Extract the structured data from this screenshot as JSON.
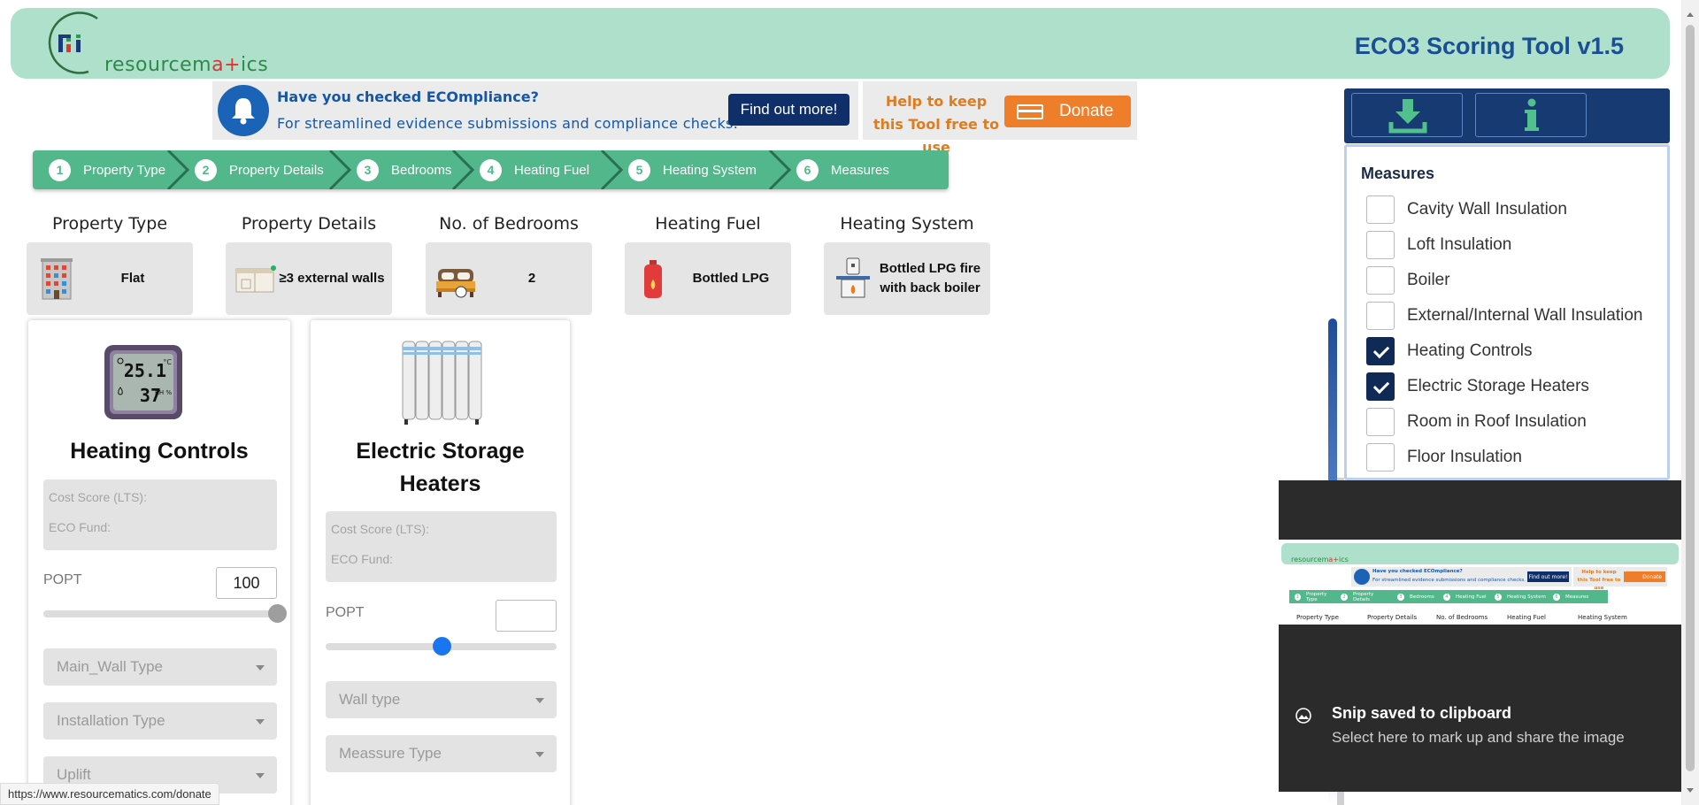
{
  "header": {
    "logo_prefix": "resourcem",
    "logo_accent": "a+",
    "logo_suffix": "ics",
    "app_title": "ECO3 Scoring Tool v1.5"
  },
  "banner": {
    "line1": "Have you checked ECOmpliance?",
    "line2": "For streamlined evidence submissions and compliance checks.",
    "find_out_more": "Find out more!",
    "help_text": "Help to keep this Tool free to use",
    "donate": "Donate"
  },
  "steps": [
    {
      "num": "1",
      "label": "Property Type"
    },
    {
      "num": "2",
      "label": "Property Details"
    },
    {
      "num": "3",
      "label": "Bedrooms"
    },
    {
      "num": "4",
      "label": "Heating Fuel"
    },
    {
      "num": "5",
      "label": "Heating System"
    },
    {
      "num": "6",
      "label": "Measures"
    }
  ],
  "summary": [
    {
      "label": "Property Type",
      "value": "Flat",
      "icon": "building-icon"
    },
    {
      "label": "Property Details",
      "value": "≥3 external walls",
      "icon": "walls-icon"
    },
    {
      "label": "No. of Bedrooms",
      "value": "2",
      "icon": "bed-icon"
    },
    {
      "label": "Heating Fuel",
      "value": "Bottled LPG",
      "icon": "gas-bottle-icon"
    },
    {
      "label": "Heating System",
      "value": "Bottled LPG fire with back boiler",
      "icon": "fire-boiler-icon"
    }
  ],
  "cards": [
    {
      "title": "Heating Controls",
      "thermo_temp": "25.1",
      "thermo_temp_unit": "°C",
      "thermo_rh": "37",
      "thermo_rh_unit": "RH %",
      "cost_score_label": "Cost Score (LTS):",
      "eco_fund_label": "ECO Fund:",
      "popt_label": "POPT",
      "popt_value": "100",
      "popt_fraction": 1.0,
      "selects": [
        "Main_Wall Type",
        "Installation Type",
        "Uplift"
      ]
    },
    {
      "title": "Electric Storage Heaters",
      "cost_score_label": "Cost Score (LTS):",
      "eco_fund_label": "ECO Fund:",
      "popt_label": "POPT",
      "popt_value": "",
      "popt_fraction": 0.5,
      "selects": [
        "Wall type",
        "Meassure Type"
      ]
    }
  ],
  "measures_panel": {
    "title": "Measures",
    "items": [
      {
        "label": "Cavity Wall Insulation",
        "checked": false
      },
      {
        "label": "Loft Insulation",
        "checked": false
      },
      {
        "label": "Boiler",
        "checked": false
      },
      {
        "label": "External/Internal Wall Insulation",
        "checked": false
      },
      {
        "label": "Heating Controls",
        "checked": true
      },
      {
        "label": "Electric Storage Heaters",
        "checked": true
      },
      {
        "label": "Room in Roof Insulation",
        "checked": false
      },
      {
        "label": "Floor Insulation",
        "checked": false
      }
    ]
  },
  "snip": {
    "title": "Snip saved to clipboard",
    "message": "Select here to mark up and share the image"
  },
  "status_url": "https://www.resourcematics.com/donate",
  "colors": {
    "header_bg": "#aee0cb",
    "steps_bg": "#52b88c",
    "navy": "#0f2f6b",
    "donate": "#ef7e2b",
    "title_blue": "#1a4f94"
  }
}
